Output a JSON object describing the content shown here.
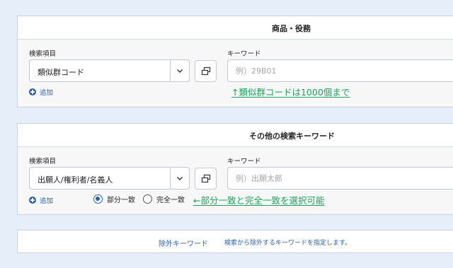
{
  "section1": {
    "title": "商品・役務",
    "field_label": "検索項目",
    "select_value": "類似群コード",
    "keyword_label": "キーワード",
    "keyword_placeholder": "例）29B01",
    "add_label": "追加",
    "note": "↑類似群コードは1000個まで"
  },
  "section2": {
    "title": "その他の検索キーワード",
    "field_label": "検索項目",
    "select_value": "出願人/権利者/名義人",
    "keyword_label": "キーワード",
    "keyword_placeholder": "例）出願太郎",
    "add_label": "追加",
    "match_options": [
      {
        "label": "部分一致",
        "checked": true
      },
      {
        "label": "完全一致",
        "checked": false
      }
    ],
    "note": "←部分一致と完全一致を選択可能"
  },
  "exclude": {
    "link_label": "除外キーワード",
    "description": "検索から除外するキーワードを指定します。"
  },
  "colors": {
    "background": "#e6eef9",
    "link": "#2a5fb0",
    "annotation": "#1aa35a"
  },
  "icons": [
    "chevron-down-icon",
    "copy-icon",
    "plus-circle-icon"
  ]
}
